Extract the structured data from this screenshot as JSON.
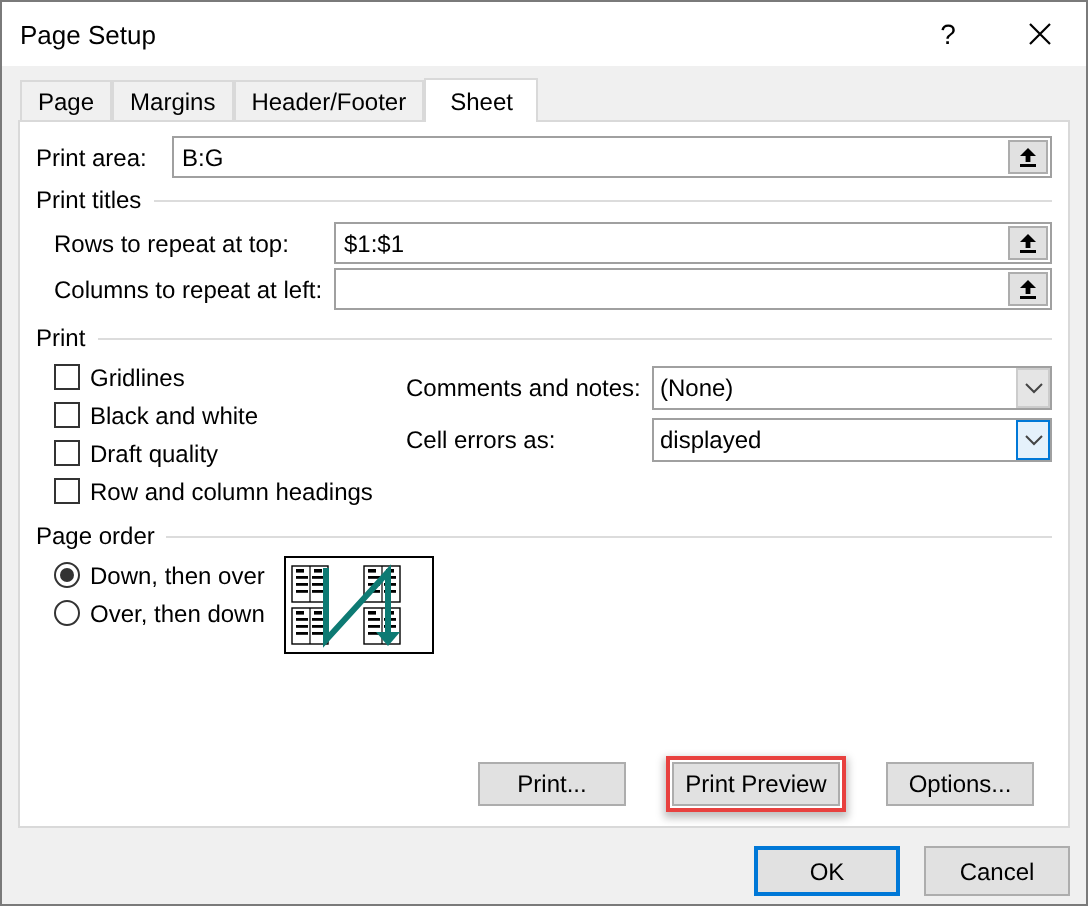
{
  "window": {
    "title": "Page Setup",
    "help": "?"
  },
  "tabs": [
    {
      "label": "Page",
      "selected": false
    },
    {
      "label": "Margins",
      "selected": false
    },
    {
      "label": "Header/Footer",
      "selected": false
    },
    {
      "label": "Sheet",
      "selected": true
    }
  ],
  "print_area": {
    "label": "Print area:",
    "value": "B:G"
  },
  "print_titles": {
    "heading": "Print titles",
    "fields": [
      {
        "label": "Rows to repeat at top:",
        "value": "$1:$1"
      },
      {
        "label": "Columns to repeat at left:"
      }
    ]
  },
  "print": {
    "heading": "Print",
    "options": [
      {
        "label": "Gridlines",
        "checked": false
      },
      {
        "label": "Black and white",
        "checked": false
      },
      {
        "label": "Draft quality",
        "checked": false
      },
      {
        "label": "Row and column headings",
        "checked": false
      }
    ],
    "dropdowns": [
      {
        "label": "Comments and notes:",
        "value": "(None)",
        "focused": false
      },
      {
        "label": "Cell errors as:",
        "value": "displayed",
        "focused": true
      }
    ]
  },
  "page_order": {
    "heading": "Page order",
    "options": [
      {
        "label": "Down, then over",
        "selected": true
      },
      {
        "label": "Over, then down",
        "selected": false
      }
    ]
  },
  "sheet_buttons": [
    {
      "label": "Print...",
      "highlighted": false
    },
    {
      "label": "Print Preview",
      "highlighted": true
    },
    {
      "label": "Options...",
      "highlighted": false
    }
  ],
  "dialog_buttons": [
    {
      "label": "OK",
      "default": true
    },
    {
      "label": "Cancel",
      "default": false
    }
  ]
}
